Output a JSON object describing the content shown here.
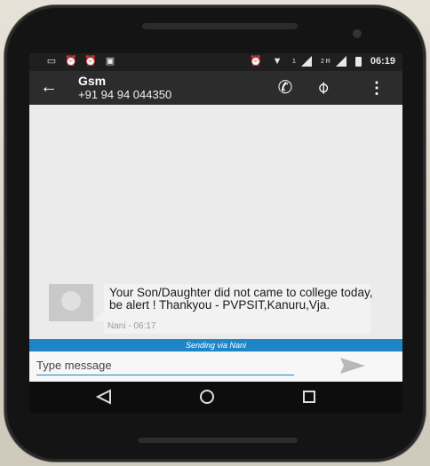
{
  "status_bar": {
    "left_icons": [
      "message-icon",
      "alarm-icon",
      "alarm-icon",
      "briefcase-icon"
    ],
    "right_icons": [
      "alarm-icon",
      "wifi-icon",
      "signal-icon",
      "signal-icon",
      "battery-icon"
    ],
    "sim1_label": "1",
    "sim2_label": "2 R",
    "time": "06:19"
  },
  "toolbar": {
    "contact_name": "Gsm",
    "contact_number": "+91 94 94 044350",
    "back_icon": "arrow-left-icon",
    "call_icon": "phone-icon",
    "attach_icon": "paperclip-icon",
    "menu_icon": "more-vert-icon"
  },
  "conversation": {
    "messages": [
      {
        "text": "Your Son/Daughter did not came to college today, be alert ! Thankyou - PVPSIT,Kanuru,Vja.",
        "meta": "Nani - 06:17"
      }
    ]
  },
  "sending_bar": {
    "text": "Sending via Nani"
  },
  "compose": {
    "placeholder": "Type message",
    "send_icon": "send-icon"
  },
  "nav_bar": {
    "icons": [
      "nav-back-icon",
      "nav-home-icon",
      "nav-recents-icon"
    ]
  },
  "colors": {
    "accent": "#1f86c6",
    "toolbar": "#2c2c2c",
    "status_bar": "#1f1f1f"
  }
}
